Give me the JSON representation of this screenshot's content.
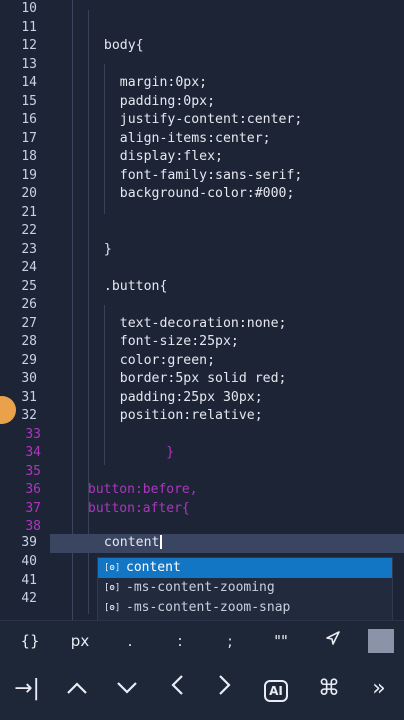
{
  "editor": {
    "lines": [
      {
        "n": "10",
        "t": ""
      },
      {
        "n": "11",
        "t": ""
      },
      {
        "n": "12",
        "t": "  body{"
      },
      {
        "n": "13",
        "t": ""
      },
      {
        "n": "14",
        "t": "    margin:0px;"
      },
      {
        "n": "15",
        "t": "    padding:0px;"
      },
      {
        "n": "16",
        "t": "    justify-content:center;"
      },
      {
        "n": "17",
        "t": "    align-items:center;"
      },
      {
        "n": "18",
        "t": "    display:flex;"
      },
      {
        "n": "19",
        "t": "    font-family:sans-serif;"
      },
      {
        "n": "20",
        "t": "    background-color:#000;"
      },
      {
        "n": "21",
        "t": ""
      },
      {
        "n": "22",
        "t": ""
      },
      {
        "n": "23",
        "t": "  }"
      },
      {
        "n": "24",
        "t": ""
      },
      {
        "n": "25",
        "t": "  .button{"
      },
      {
        "n": "26",
        "t": ""
      },
      {
        "n": "27",
        "t": "    text-decoration:none;"
      },
      {
        "n": "28",
        "t": "    font-size:25px;"
      },
      {
        "n": "29",
        "t": "    color:green;"
      },
      {
        "n": "30",
        "t": "    border:5px solid red;"
      },
      {
        "n": "31",
        "t": "    padding:25px 30px;"
      },
      {
        "n": "32",
        "t": "    position:relative;"
      }
    ],
    "ghost_lines": [
      {
        "n": "33",
        "t": ""
      },
      {
        "n": "34",
        "t": "          }"
      },
      {
        "n": "35",
        "t": ""
      },
      {
        "n": "36",
        "t": "button:before,"
      },
      {
        "n": "37",
        "t": "button:after{"
      },
      {
        "n": "38",
        "t": ""
      }
    ],
    "current": {
      "n": "39",
      "t": "  content"
    },
    "after": [
      {
        "n": "40",
        "t": ""
      },
      {
        "n": "41",
        "t": ""
      },
      {
        "n": "42",
        "t": ""
      }
    ]
  },
  "autocomplete": {
    "items": [
      {
        "icon": "[ꙩ]",
        "label": "content"
      },
      {
        "icon": "[ꙩ]",
        "label": "-ms-content-zooming"
      },
      {
        "icon": "[ꙩ]",
        "label": "-ms-content-zoom-snap"
      }
    ]
  },
  "keyboard": {
    "row1": [
      "{}",
      "px",
      ".",
      ":",
      ";",
      "\"\""
    ],
    "row2": [
      "→|",
      "⌃",
      "⌄",
      "‹",
      "›",
      "AI",
      "⌘",
      "»"
    ]
  }
}
